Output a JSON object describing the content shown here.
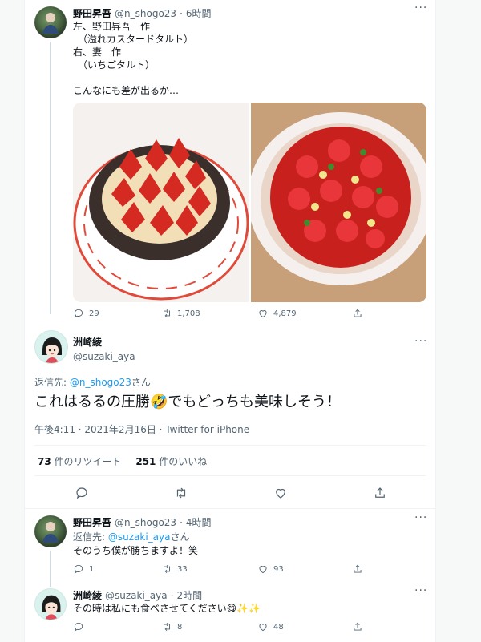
{
  "tweet1": {
    "name": "野田昇吾",
    "handle": "@n_shogo23",
    "time": "6時間",
    "lines": [
      "左、野田昇吾　作",
      "（溢れカスタードタルト）",
      "右、妻　作",
      "（いちごタルト）",
      "",
      "こんなにも差が出るか…"
    ],
    "stats": {
      "replies": "29",
      "retweets": "1,708",
      "likes": "4,879"
    }
  },
  "main": {
    "name": "洲崎綾",
    "handle": "@suzaki_aya",
    "reply_to_prefix": "返信先: ",
    "reply_to_handle": "@n_shogo23",
    "reply_to_suffix": "さん",
    "text": "これはるるの圧勝",
    "emoji": "🤣",
    "text2": "でもどっちも美味しそう！",
    "timestamp": "午後4:11 · 2021年2月16日 · Twitter for iPhone",
    "retweet_count": "73",
    "retweet_label": " 件のリツイート",
    "like_count": "251",
    "like_label": " 件のいいね"
  },
  "reply1": {
    "name": "野田昇吾",
    "handle": "@n_shogo23",
    "time": "4時間",
    "reply_to_prefix": "返信先: ",
    "reply_to_handle": "@suzaki_aya",
    "reply_to_suffix": "さん",
    "text": "そのうち僕が勝ちますよ！笑",
    "stats": {
      "replies": "1",
      "retweets": "33",
      "likes": "93"
    }
  },
  "reply2": {
    "name": "洲崎綾",
    "handle": "@suzaki_aya",
    "time": "2時間",
    "text": "その時は私にも食べさせてください",
    "emoji": "😋✨✨",
    "stats": {
      "replies": "",
      "retweets": "8",
      "likes": "48"
    }
  },
  "more_icon": "···",
  "icons": [
    "reply-icon",
    "retweet-icon",
    "like-icon",
    "share-icon",
    "more-icon"
  ],
  "colors": {
    "link": "#1d9bf0",
    "muted": "#536471",
    "divider": "#eff3f4"
  }
}
